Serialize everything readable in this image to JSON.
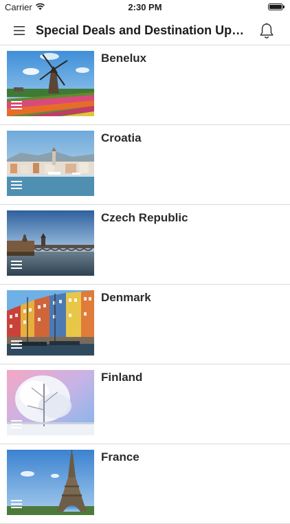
{
  "status_bar": {
    "carrier": "Carrier",
    "time": "2:30 PM"
  },
  "nav": {
    "title": "Special Deals and Destination Upda..."
  },
  "destinations": [
    {
      "name": "Benelux"
    },
    {
      "name": "Croatia"
    },
    {
      "name": "Czech Republic"
    },
    {
      "name": "Denmark"
    },
    {
      "name": "Finland"
    },
    {
      "name": "France"
    }
  ],
  "icons": {
    "menu": "hamburger-menu-icon",
    "notifications": "bell-icon",
    "row_handle": "list-lines-icon",
    "wifi": "wifi-icon",
    "battery": "battery-icon"
  }
}
